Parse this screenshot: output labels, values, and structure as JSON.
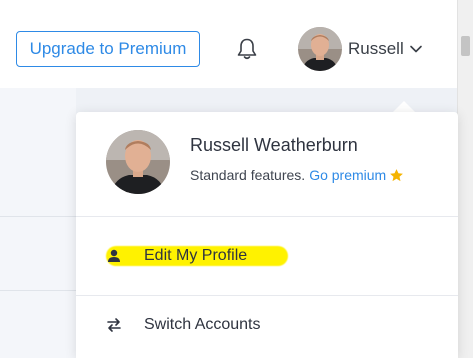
{
  "header": {
    "upgrade_label": "Upgrade to Premium",
    "user_short_name": "Russell"
  },
  "dropdown": {
    "full_name": "Russell Weatherburn",
    "plan_text": "Standard features.",
    "go_premium_label": "Go premium",
    "items": [
      {
        "label": "Edit My Profile",
        "icon": "user-icon",
        "highlighted": true
      },
      {
        "label": "Switch Accounts",
        "icon": "swap-arrows-icon",
        "highlighted": false
      }
    ]
  },
  "colors": {
    "accent": "#2e8ae6",
    "star": "#f5b400",
    "highlight": "#fff200",
    "text": "#2f3440"
  },
  "icons": [
    "bell-icon",
    "chevron-down-icon",
    "star-icon",
    "user-icon",
    "swap-arrows-icon"
  ]
}
